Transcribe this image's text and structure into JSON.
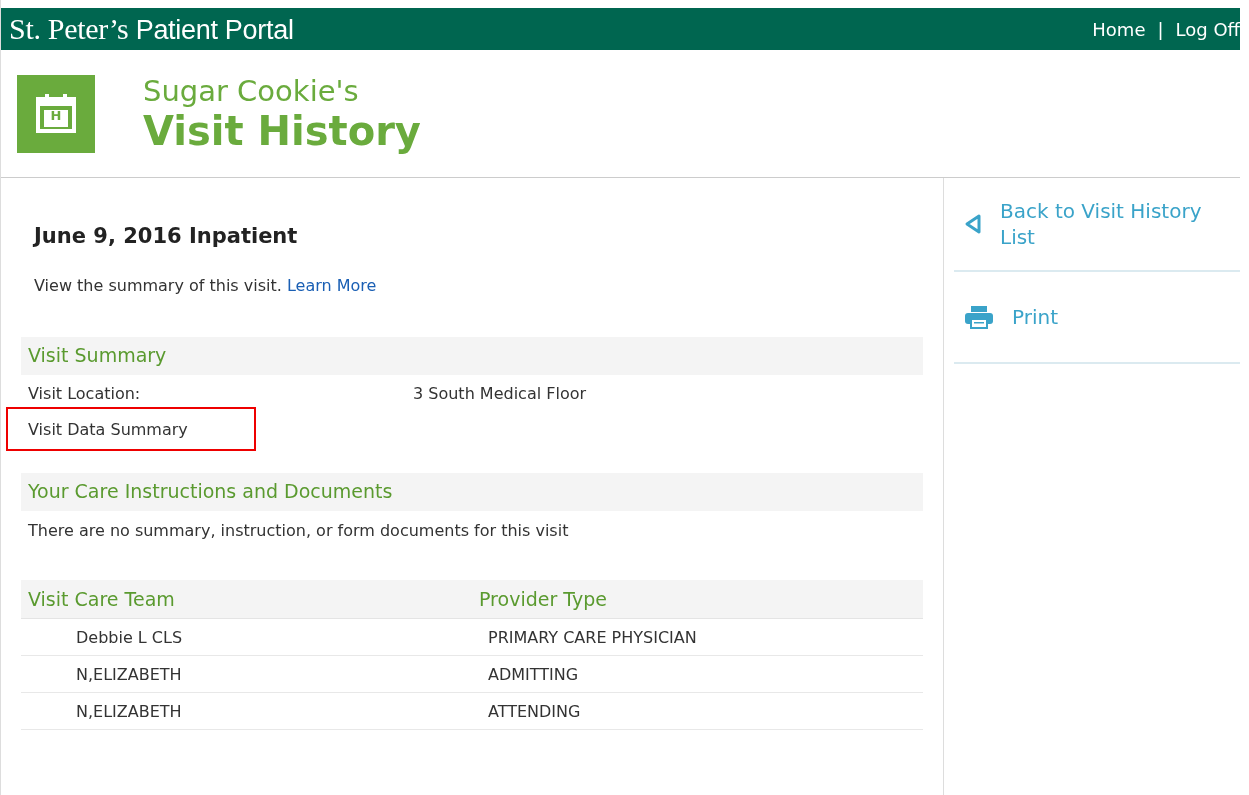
{
  "top_bar": {
    "brand_serif": "St. Peter’s",
    "brand_sans": "Patient Portal",
    "links": [
      {
        "label": "Home"
      },
      {
        "label": "Log Off"
      }
    ],
    "separator": "|"
  },
  "header": {
    "owner": "Sugar Cookie's",
    "title": "Visit History",
    "icon_letter": "H"
  },
  "visit": {
    "title": "June 9, 2016 Inpatient",
    "intro": "View the summary of this visit.",
    "learn_more": "Learn More"
  },
  "summary": {
    "heading": "Visit Summary",
    "rows": [
      {
        "label": "Visit Location:",
        "value": "3 South Medical Floor",
        "highlighted": false
      },
      {
        "label": "Visit Data Summary",
        "highlighted": true
      }
    ]
  },
  "documents": {
    "heading": "Your Care Instructions and Documents",
    "message": "There are no summary, instruction, or form documents for this visit"
  },
  "care_team": {
    "columns": [
      "Visit Care Team",
      "Provider Type"
    ],
    "rows": [
      [
        "Debbie L CLS",
        "PRIMARY CARE PHYSICIAN"
      ],
      [
        "N,ELIZABETH",
        "ADMITTING"
      ],
      [
        "N,ELIZABETH",
        "ATTENDING"
      ]
    ]
  },
  "sidebar": {
    "items": [
      {
        "kind": "back",
        "label": "Back to Visit History List"
      },
      {
        "kind": "print",
        "label": "Print"
      }
    ]
  }
}
